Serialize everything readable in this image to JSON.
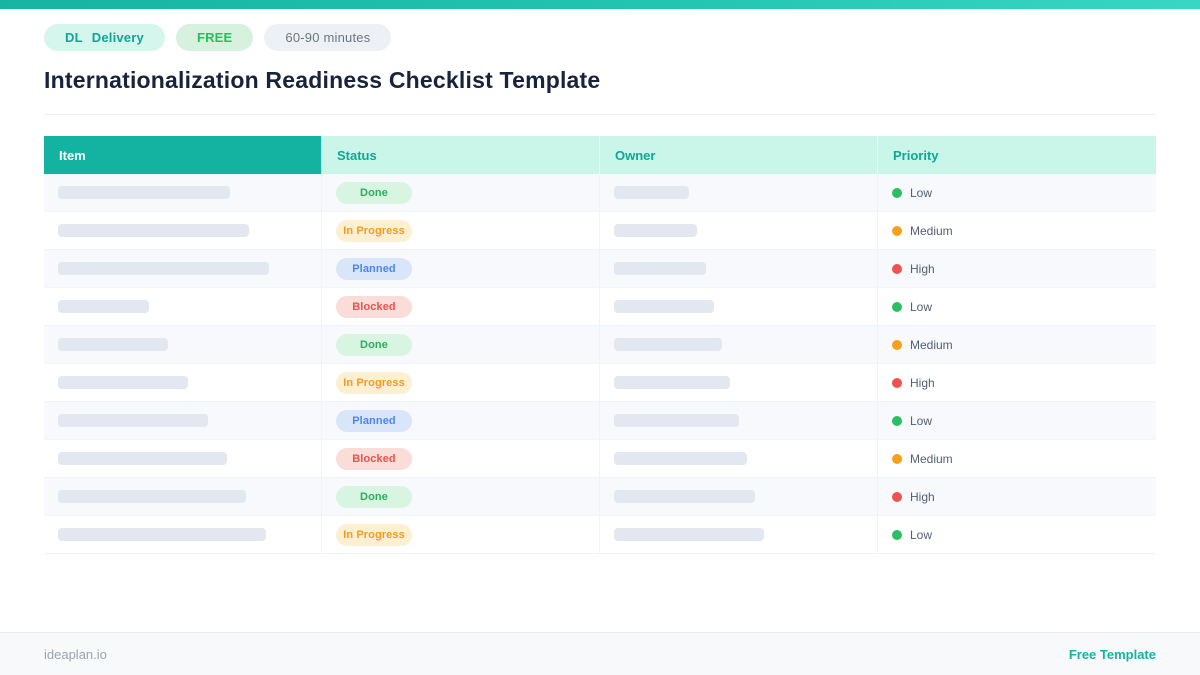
{
  "accent": {
    "gradient_start": "#17b3a3",
    "gradient_end": "#3ad6c4"
  },
  "header": {
    "badges": {
      "category": {
        "prefix": "DL",
        "label": "Delivery",
        "fg": "#12a594",
        "bg": "#d5f6ec"
      },
      "free": {
        "label": "FREE",
        "fg": "#1fc35c",
        "bg": "#d7f1df"
      },
      "duration": {
        "label": "60-90 minutes",
        "fg": "#6b7684",
        "bg": "#edf0f5"
      }
    },
    "title": "Internationalization Readiness Checklist Template"
  },
  "table": {
    "columns": [
      "Item",
      "Status",
      "Owner",
      "Priority"
    ],
    "header_colors": {
      "first_bg": "#14b3a1",
      "first_fg": "#ffffff",
      "rest_bg": "#c9f6e9",
      "rest_fg": "#10a795"
    },
    "status_styles": {
      "Done": {
        "fg": "#2bae5c",
        "bg": "#d8f5e2"
      },
      "In Progress": {
        "fg": "#f79a1f",
        "bg": "#fdefd2"
      },
      "Planned": {
        "fg": "#4b86f0",
        "bg": "#d9e6fa"
      },
      "Blocked": {
        "fg": "#e4564d",
        "bg": "#fadcd9"
      }
    },
    "priority_styles": {
      "Low": "#2abf62",
      "Medium": "#f6a11c",
      "High": "#ef5350"
    },
    "rows": [
      {
        "item_bar_width": 172,
        "status": "Done",
        "owner_bar_width": 75,
        "priority": "Low"
      },
      {
        "item_bar_width": 191,
        "status": "In Progress",
        "owner_bar_width": 83,
        "priority": "Medium"
      },
      {
        "item_bar_width": 211,
        "status": "Planned",
        "owner_bar_width": 92,
        "priority": "High"
      },
      {
        "item_bar_width": 91,
        "status": "Blocked",
        "owner_bar_width": 100,
        "priority": "Low"
      },
      {
        "item_bar_width": 110,
        "status": "Done",
        "owner_bar_width": 108,
        "priority": "Medium"
      },
      {
        "item_bar_width": 130,
        "status": "In Progress",
        "owner_bar_width": 116,
        "priority": "High"
      },
      {
        "item_bar_width": 150,
        "status": "Planned",
        "owner_bar_width": 125,
        "priority": "Low"
      },
      {
        "item_bar_width": 169,
        "status": "Blocked",
        "owner_bar_width": 133,
        "priority": "Medium"
      },
      {
        "item_bar_width": 188,
        "status": "Done",
        "owner_bar_width": 141,
        "priority": "High"
      },
      {
        "item_bar_width": 208,
        "status": "In Progress",
        "owner_bar_width": 150,
        "priority": "Low"
      }
    ]
  },
  "footer": {
    "brand": "ideaplan.io",
    "link": "Free Template"
  }
}
